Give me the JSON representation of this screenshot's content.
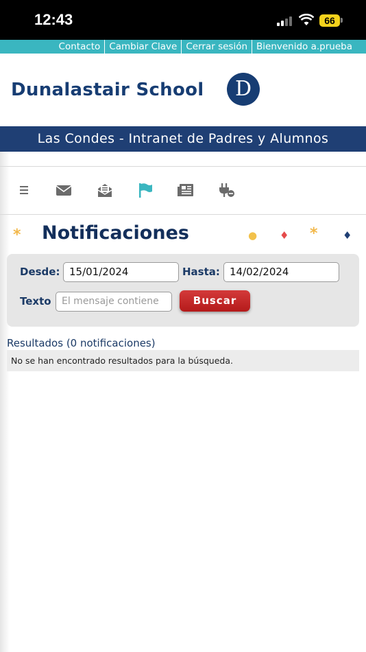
{
  "status_bar": {
    "time": "12:43",
    "battery": "66",
    "icons": [
      "signal-icon",
      "wifi-icon",
      "battery-icon"
    ]
  },
  "top_links": [
    "Contacto",
    "Cambiar Clave",
    "Cerrar sesión",
    "Bienvenido a.prueba"
  ],
  "header": {
    "school_name": "Dunalastair School",
    "logo_letter": "D"
  },
  "banner": "Las Condes - Intranet de Padres y Alumnos",
  "toolbar_icons": [
    "menu-icon",
    "envelope-icon",
    "open-mail-icon",
    "flag-icon",
    "newspaper-icon",
    "plug-icon"
  ],
  "page": {
    "star": "*",
    "title": "Notificaciones",
    "decor": [
      {
        "glyph": "●",
        "color": "#f2c14b"
      },
      {
        "glyph": "♦",
        "color": "#e54b4b"
      },
      {
        "glyph": "*",
        "color": "#f2b84b"
      },
      {
        "glyph": "♦",
        "color": "#1f3f74"
      }
    ]
  },
  "filters": {
    "desde_label": "Desde:",
    "desde_value": "15/01/2024",
    "hasta_label": "Hasta:",
    "hasta_value": "14/02/2024",
    "texto_label": "Texto",
    "texto_placeholder": "El mensaje contiene",
    "search_button": "Buscar"
  },
  "results": {
    "title": "Resultados (0 notificaciones)",
    "empty_message": "No se han encontrado resultados para la búsqueda."
  },
  "colors": {
    "accent_teal": "#3ab6c0",
    "brand_navy": "#1f3f74",
    "button_red": "#c42a2a"
  }
}
